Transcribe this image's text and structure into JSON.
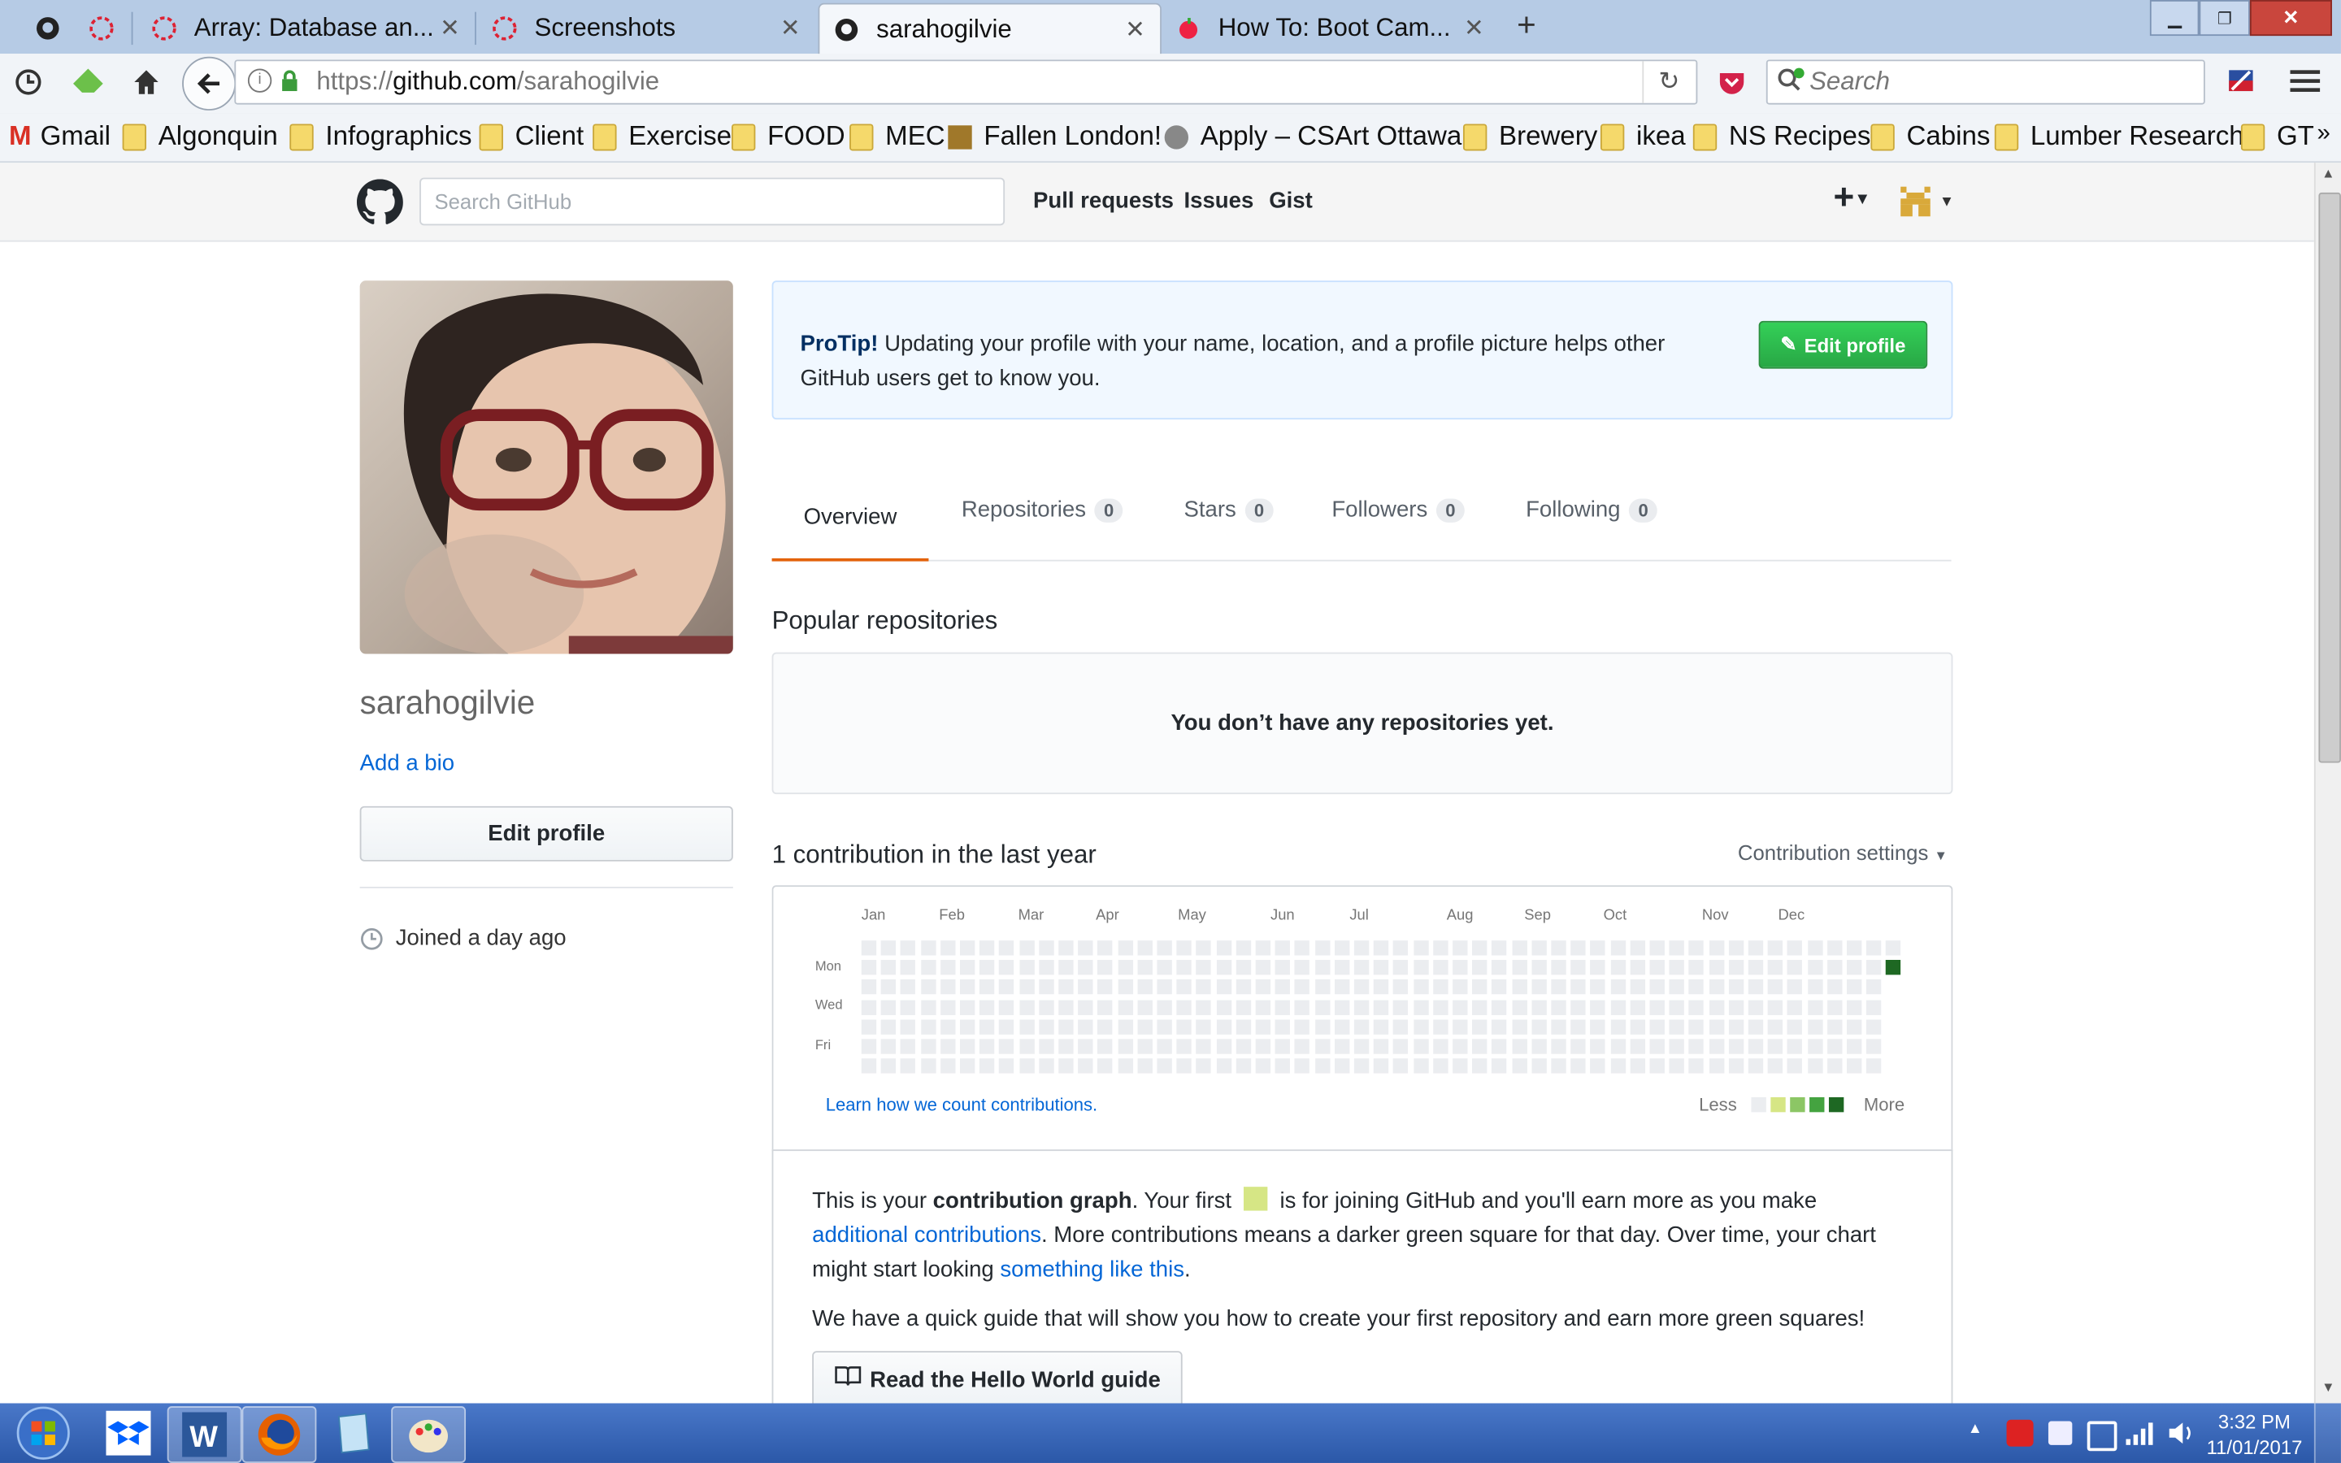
{
  "browser": {
    "tabs": [
      {
        "label": ""
      },
      {
        "label": ""
      },
      {
        "label": "Array: Database an..."
      },
      {
        "label": "Screenshots"
      },
      {
        "label": "sarahogilvie"
      },
      {
        "label": "How To: Boot Cam..."
      }
    ],
    "url_prefix": "https://",
    "url_domain": "github.com",
    "url_path": "/sarahogilvie",
    "search_placeholder": "Search",
    "bookmarks": [
      "Gmail",
      "Algonquin",
      "Infographics",
      "Client",
      "Exercise",
      "FOOD",
      "MEC",
      "Fallen London!",
      "Apply – CSArt Ottawa",
      "Brewery",
      "ikea",
      "NS Recipes",
      "Cabins",
      "Lumber Research",
      "GT"
    ]
  },
  "github": {
    "search_placeholder": "Search GitHub",
    "nav": [
      "Pull requests",
      "Issues",
      "Gist"
    ],
    "plus_label": "+",
    "protip_bold": "ProTip!",
    "protip_text": "Updating your profile with your name, location, and a profile picture helps other GitHub users get to know you.",
    "edit_profile_green": "Edit profile",
    "tabs": [
      {
        "label": "Overview",
        "count": ""
      },
      {
        "label": "Repositories",
        "count": "0"
      },
      {
        "label": "Stars",
        "count": "0"
      },
      {
        "label": "Followers",
        "count": "0"
      },
      {
        "label": "Following",
        "count": "0"
      }
    ],
    "username": "sarahogilvie",
    "add_bio": "Add a bio",
    "edit_profile": "Edit profile",
    "joined": "Joined a day ago",
    "popular_title": "Popular repositories",
    "no_repos": "You don’t have any repositories yet.",
    "contrib_title": "1 contribution in the last year",
    "contrib_settings": "Contribution settings",
    "months": [
      "Jan",
      "Feb",
      "Mar",
      "Apr",
      "May",
      "Jun",
      "Jul",
      "Aug",
      "Sep",
      "Oct",
      "Nov",
      "Dec"
    ],
    "weekdays": [
      "Mon",
      "Wed",
      "Fri"
    ],
    "learn_link": "Learn how we count contributions.",
    "less": "Less",
    "more": "More",
    "legend_colors": [
      "#ebedf0",
      "#d6e685",
      "#8cc665",
      "#44a340",
      "#1e6823"
    ],
    "info": {
      "p1_a": "This is your ",
      "p1_b": "contribution graph",
      "p1_c": ". Your first ",
      "p1_d": " is for joining GitHub and you'll earn more as you make ",
      "p1_link1": "additional contributions",
      "p1_e": ". More contributions means a darker green square for that day. Over time, your chart might start looking ",
      "p1_link2": "something like this",
      "p1_f": ".",
      "p2": "We have a quick guide that will show you how to create your first repository and earn more green squares!",
      "guide_button": "Read the Hello World guide"
    }
  },
  "taskbar": {
    "time": "3:32 PM",
    "date": "11/01/2017"
  },
  "colors": {
    "accent_green": "#2cbe4e",
    "link_blue": "#0366d6",
    "tab_underline": "#e36209"
  }
}
